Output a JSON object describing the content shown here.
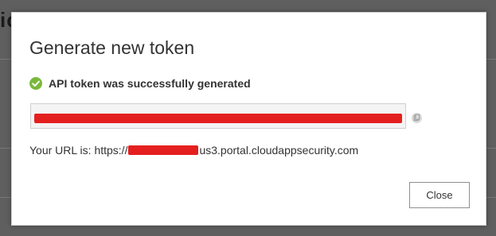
{
  "background": {
    "partial_heading": "ic"
  },
  "dialog": {
    "title": "Generate new token",
    "status_text": "API token was successfully generated",
    "url_label": "Your URL is: https://",
    "url_suffix": "us3.portal.cloudappsecurity.com",
    "close_label": "Close"
  },
  "icons": {
    "status": "check-circle-icon",
    "copy": "copy-icon"
  },
  "colors": {
    "success": "#7ab83b",
    "redaction": "#e4201f"
  }
}
